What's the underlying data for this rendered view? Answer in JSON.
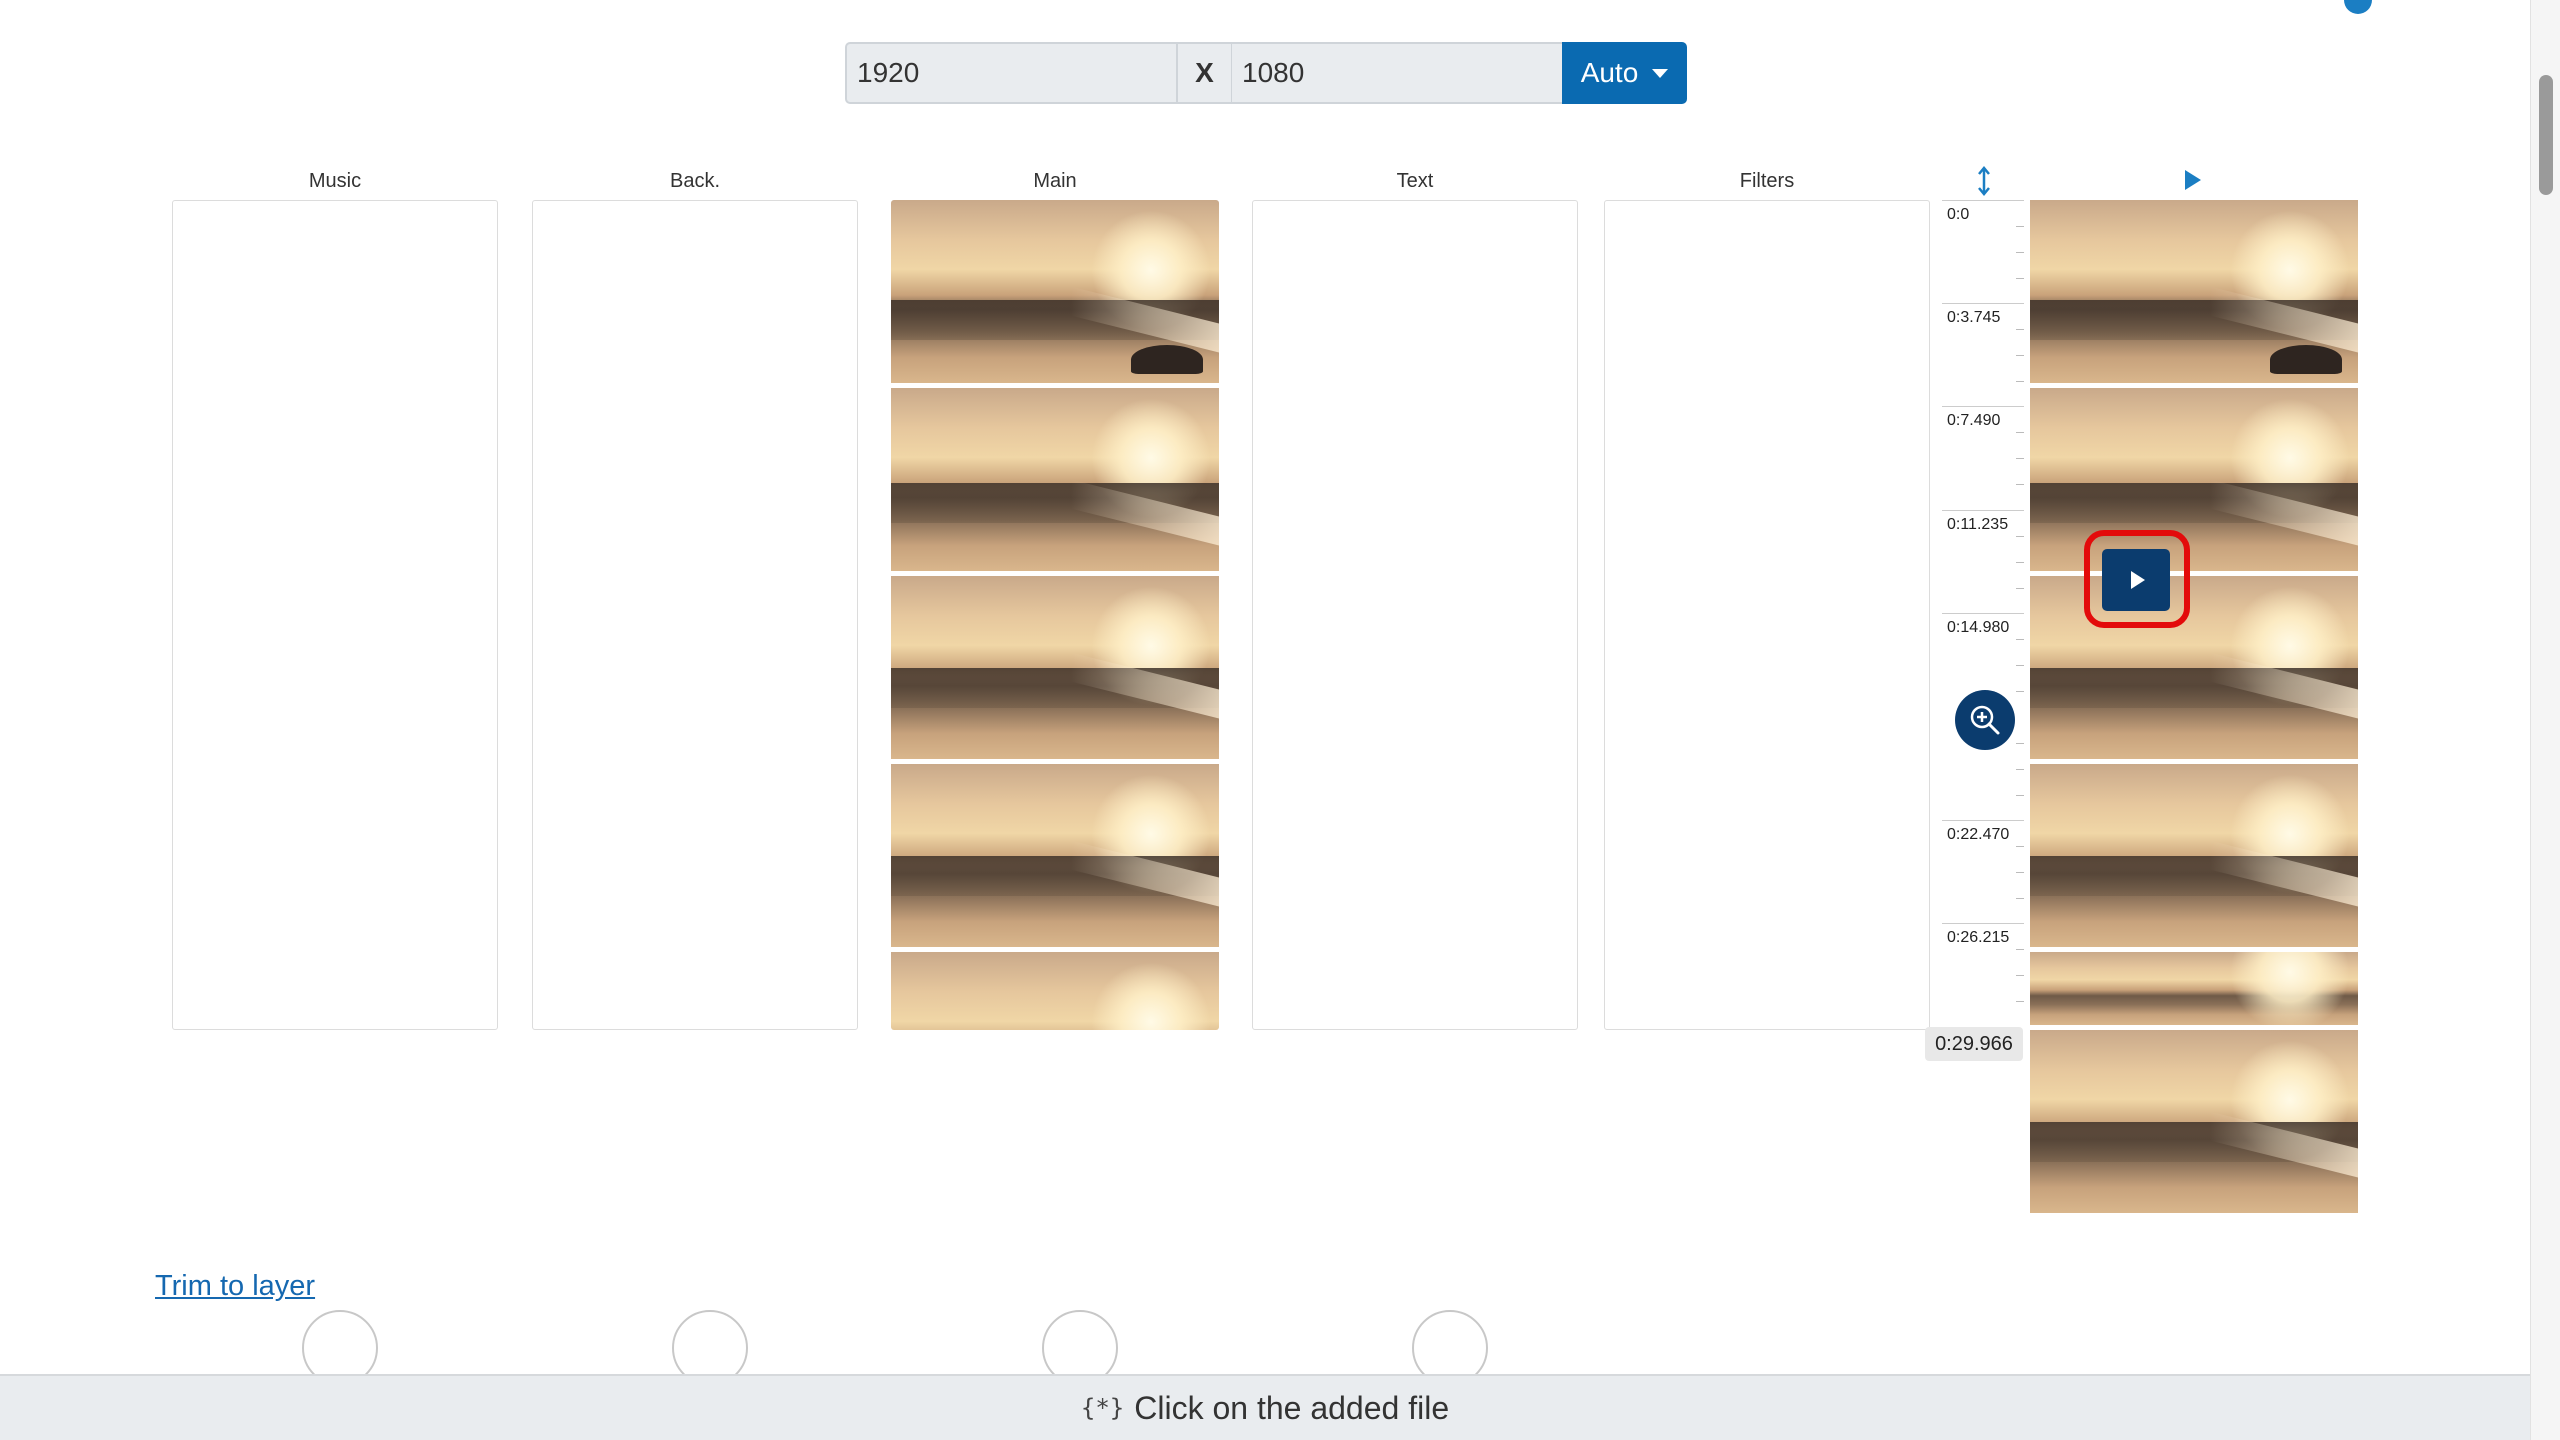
{
  "resolution": {
    "width": "1920",
    "separator": "X",
    "height": "1080",
    "mode_label": "Auto"
  },
  "layers": [
    {
      "key": "music",
      "label": "Music"
    },
    {
      "key": "back",
      "label": "Back."
    },
    {
      "key": "main",
      "label": "Main"
    },
    {
      "key": "text",
      "label": "Text"
    },
    {
      "key": "filters",
      "label": "Filters"
    }
  ],
  "timeline": {
    "marks": [
      "0:0",
      "0:3.745",
      "0:7.490",
      "0:11.235",
      "0:14.980",
      "0:22.470",
      "0:26.215"
    ],
    "end": "0:29.966"
  },
  "icons": {
    "resize": "vertical-resize-icon",
    "play_header": "play-icon",
    "zoom": "zoom-in-icon",
    "preview_play": "play-icon",
    "status": "sparkle-brace-icon"
  },
  "colors": {
    "accent": "#0a6ab1",
    "dark_button": "#0b3c6e",
    "highlight": "#e30b0b"
  },
  "trim_label": "Trim to layer",
  "status": {
    "icon_glyph": "{*}",
    "text": "Click on the added file"
  }
}
